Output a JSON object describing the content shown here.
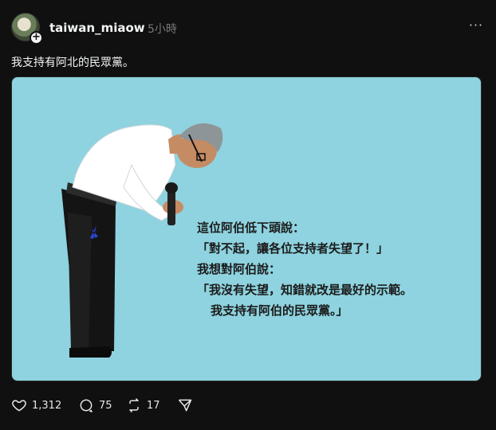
{
  "post": {
    "username": "taiwan_miaow",
    "time": "5小時",
    "more_label": "···",
    "text": "我支持有阿北的民眾黨。",
    "image": {
      "quote_lines": [
        "這位阿伯低下頭說：",
        "「對不起，讓各位支持者失望了！」",
        "我想對阿伯說：",
        "「我沒有失望，知錯就改是最好的示範。",
        "我支持有阿伯的民眾黨。」"
      ],
      "background_color": "#8ed3df"
    },
    "actions": {
      "likes": "1,312",
      "replies": "75",
      "reposts": "17"
    }
  },
  "icons": {
    "avatar_badge": "plus-icon",
    "like": "heart-icon",
    "reply": "comment-icon",
    "repost": "repost-icon",
    "share": "send-icon",
    "more": "more-icon"
  }
}
